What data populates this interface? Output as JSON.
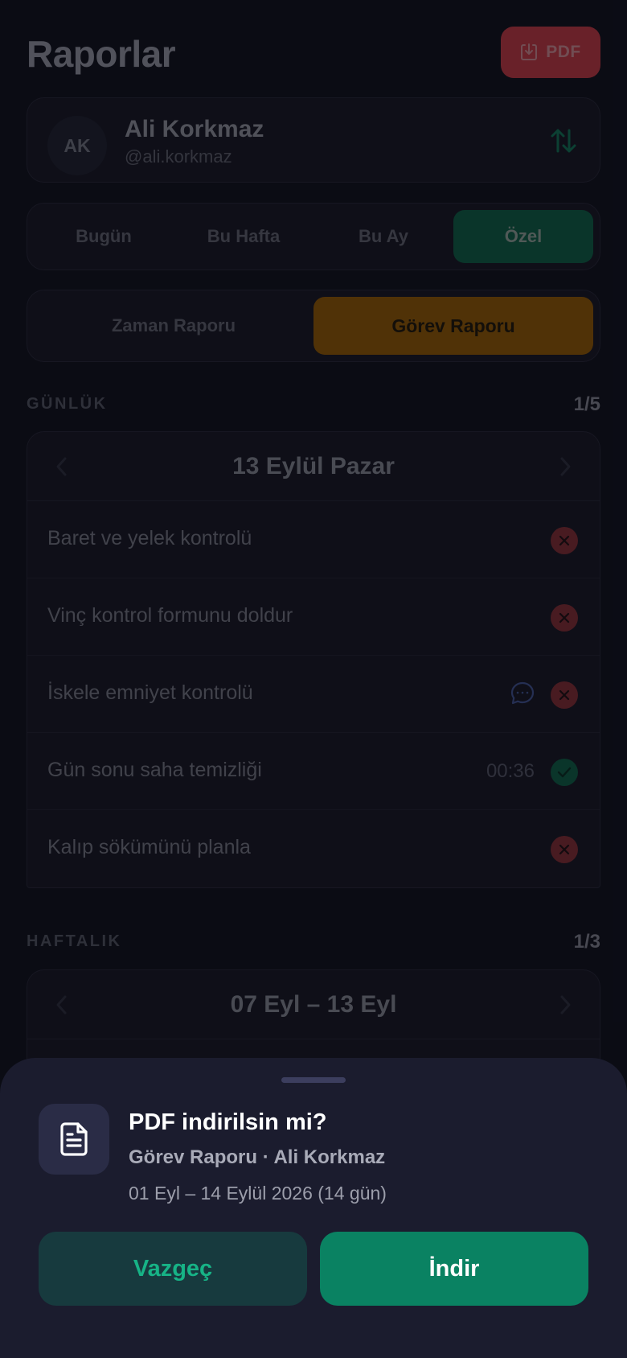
{
  "header": {
    "title": "Raporlar",
    "pdf_label": "PDF"
  },
  "user": {
    "initials": "AK",
    "name": "Ali Korkmaz",
    "handle": "@ali.korkmaz"
  },
  "period_tabs": [
    "Bugün",
    "Bu Hafta",
    "Bu Ay",
    "Özel"
  ],
  "period_active": "Özel",
  "report_tabs": [
    "Zaman Raporu",
    "Görev Raporu"
  ],
  "report_active": "Görev Raporu",
  "daily": {
    "label": "GÜNLÜK",
    "count": "1/5",
    "date": "13 Eylül Pazar",
    "tasks": [
      {
        "label": "Baret ve yelek kontrolü",
        "status": "fail",
        "icon": "x-icon"
      },
      {
        "label": "Vinç kontrol formunu doldur",
        "status": "fail",
        "icon": "x-icon"
      },
      {
        "label": "İskele emniyet kontrolü",
        "status": "fail",
        "icon": "x-icon",
        "has_comment": true
      },
      {
        "label": "Gün sonu saha temizliği",
        "status": "done",
        "icon": "check-icon",
        "time": "00:36"
      },
      {
        "label": "Kalıp sökümünü planla",
        "status": "fail",
        "icon": "x-icon"
      }
    ]
  },
  "weekly": {
    "label": "HAFTALIK",
    "count": "1/3",
    "range": "07 Eyl – 13 Eyl"
  },
  "sheet": {
    "title": "PDF indirilsin mi?",
    "subtitle": "Görev Raporu · Ali Korkmaz",
    "range": "01 Eyl – 14 Eylül 2026 (14 gün)",
    "cancel_label": "Vazgeç",
    "confirm_label": "İndir"
  },
  "colors": {
    "accent_green": "#0a8262",
    "accent_orange": "#8a5400",
    "danger": "#b8363f"
  }
}
